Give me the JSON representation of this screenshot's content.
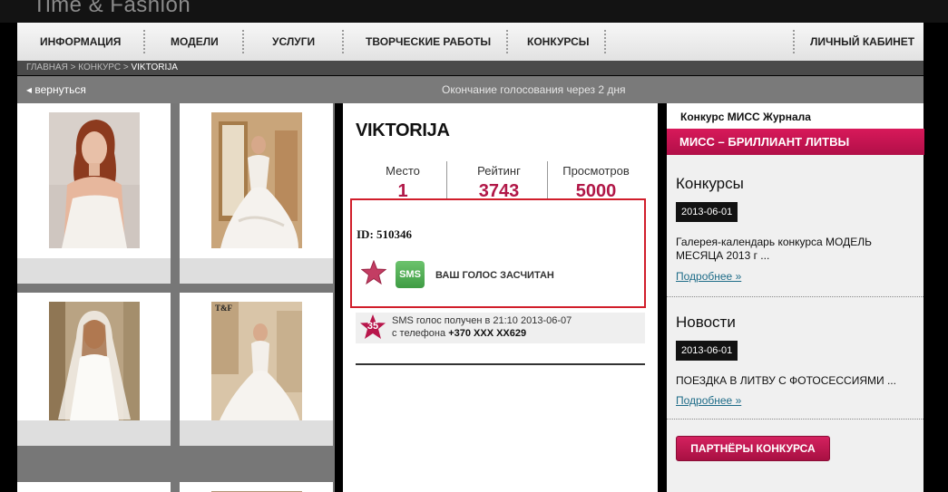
{
  "site": {
    "logo": "Time & Fashion"
  },
  "nav": {
    "items": [
      "ИНФОРМАЦИЯ",
      "МОДЕЛИ",
      "УСЛУГИ",
      "ТВОРЧЕСКИЕ РАБОТЫ",
      "КОНКУРСЫ"
    ],
    "cabinet": "ЛИЧНЫЙ КАБИНЕТ"
  },
  "breadcrumb": {
    "home": "ГЛАВНАЯ",
    "sep": ">",
    "contest": "КОНКУРС",
    "current": "VIKTORIJA"
  },
  "bar": {
    "back": "◂ вернуться",
    "deadline": "Окончание голосования через 2 дня"
  },
  "gallery": {
    "watermark": "T&F"
  },
  "profile": {
    "name": "VIKTORIJA",
    "stats": [
      {
        "label": "Место",
        "value": "1"
      },
      {
        "label": "Рейтинг",
        "value": "3743"
      },
      {
        "label": "Просмотров",
        "value": "5000"
      }
    ],
    "id_line": "ID: 510346",
    "sms_button": "SMS",
    "vote_status": "ВАШ ГОЛОС ЗАСЧИТАН",
    "sms_note": {
      "badge": "35",
      "line1": "SMS голос получен в 21:10  2013-06-07",
      "line2_prefix": "с телефона ",
      "phone": "+370 XXX XX629"
    }
  },
  "sidebar": {
    "contest_title": "Конкурс МИСС Журнала",
    "contest_name": "МИСС – БРИЛЛИАНТ ЛИТВЫ",
    "contests": {
      "heading": "Конкурсы",
      "date": "2013-06-01",
      "text": "Галерея-календарь конкурса МОДЕЛЬ МЕСЯЦА 2013 г ...",
      "more": "Подробнее »"
    },
    "news": {
      "heading": "Новости",
      "date": "2013-06-01",
      "text": "ПОЕЗДКА В ЛИТВУ С ФОТОСЕССИЯМИ ...",
      "more": "Подробнее »"
    },
    "partners_button": "ПАРТНЁРЫ КОНКУРСА"
  },
  "colors": {
    "accent": "#b11747",
    "highlight_border": "#d11e2b",
    "sms_green": "#4caf50",
    "link": "#1e6c88"
  }
}
